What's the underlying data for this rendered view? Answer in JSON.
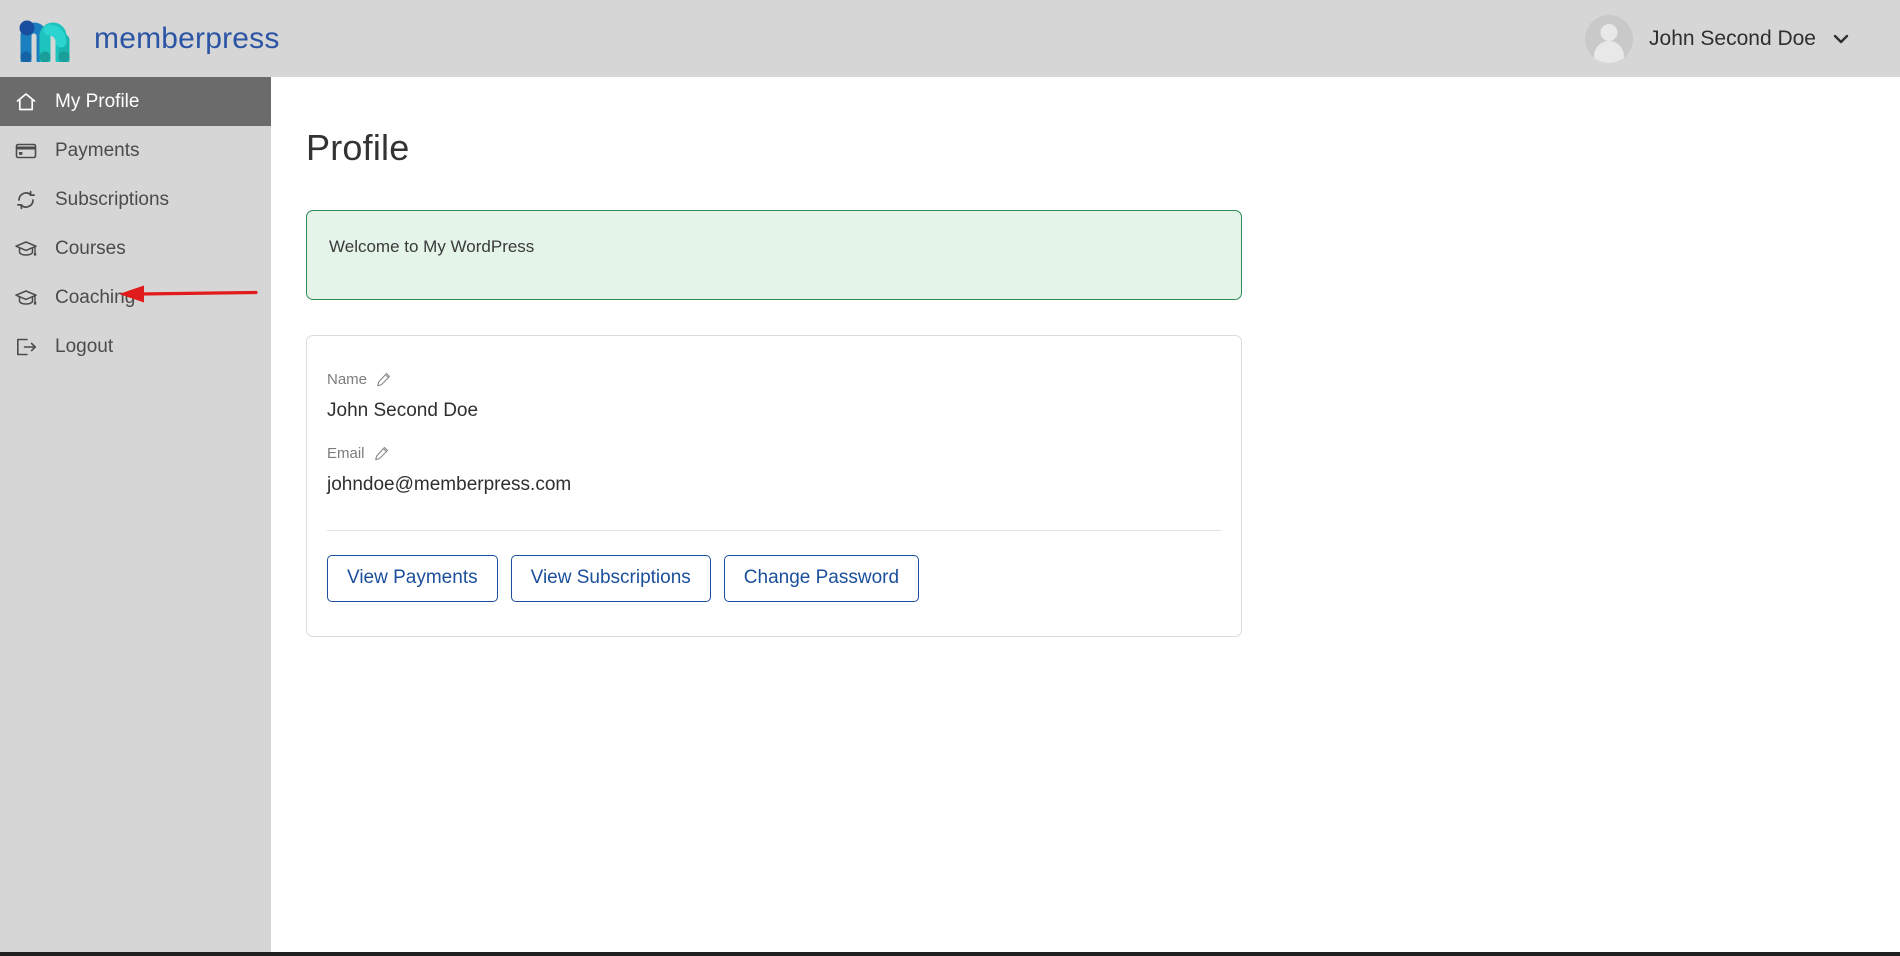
{
  "header": {
    "brand_name": "memberpress",
    "logo_icon": "memberpress-m-logo",
    "user": {
      "name": "John Second Doe",
      "avatar_icon": "user-avatar-icon",
      "chevron_icon": "chevron-down-icon"
    }
  },
  "sidebar": {
    "items": [
      {
        "label": "My Profile",
        "icon": "home-icon",
        "active": true
      },
      {
        "label": "Payments",
        "icon": "credit-card-icon",
        "active": false
      },
      {
        "label": "Subscriptions",
        "icon": "refresh-cycle-icon",
        "active": false
      },
      {
        "label": "Courses",
        "icon": "graduation-cap-icon",
        "active": false
      },
      {
        "label": "Coaching",
        "icon": "graduation-cap-icon",
        "active": false
      },
      {
        "label": "Logout",
        "icon": "logout-icon",
        "active": false
      }
    ]
  },
  "main": {
    "page_title": "Profile",
    "notice": {
      "text": "Welcome to My WordPress",
      "border_color": "#2e8b57",
      "background_color": "#e4f4e9"
    },
    "profile_card": {
      "fields": [
        {
          "label": "Name",
          "value": "John Second Doe",
          "edit_icon": "pencil-icon"
        },
        {
          "label": "Email",
          "value": "johndoe@memberpress.com",
          "edit_icon": "pencil-icon"
        }
      ],
      "buttons": [
        {
          "label": "View Payments"
        },
        {
          "label": "View Subscriptions"
        },
        {
          "label": "Change Password"
        }
      ]
    }
  },
  "annotation": {
    "arrow_color": "#e01b1b",
    "points_to": "Coaching"
  }
}
